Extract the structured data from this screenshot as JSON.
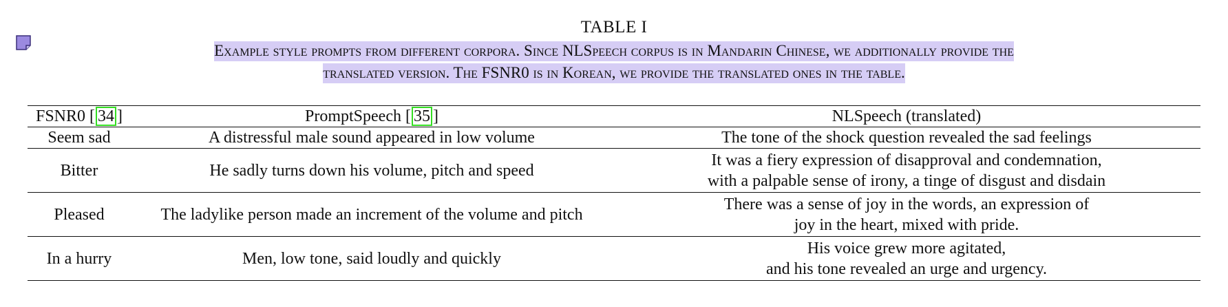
{
  "table_title": "TABLE I",
  "caption": {
    "line1": "Example style prompts from different corpora. Since NLSpeech corpus is in Mandarin Chinese, we additionally provide the",
    "line2": "translated version. The FSNR0 is in Korean, we provide the translated ones in the table."
  },
  "table": {
    "headers": [
      {
        "label": "FSNR0",
        "ref": "34"
      },
      {
        "label": "PromptSpeech",
        "ref": "35"
      },
      {
        "label": "NLSpeech (translated)"
      }
    ],
    "rows": [
      {
        "fsnr0": "Seem sad",
        "promptspeech": "A distressful male sound appeared in low volume",
        "nlspeech": [
          "The tone of the shock question revealed the sad feelings"
        ]
      },
      {
        "fsnr0": "Bitter",
        "promptspeech": "He sadly turns down his volume, pitch and speed",
        "nlspeech": [
          "It was a fiery expression of disapproval and condemnation,",
          "with a palpable sense of irony, a tinge of disgust and disdain"
        ]
      },
      {
        "fsnr0": "Pleased",
        "promptspeech": "The ladylike person made an increment of the volume and pitch",
        "nlspeech": [
          "There was a sense of joy in the words, an expression of",
          "joy in the heart, mixed with pride."
        ]
      },
      {
        "fsnr0": "In a hurry",
        "promptspeech": "Men, low tone, said loudly and quickly",
        "nlspeech": [
          "His voice grew more agitated,",
          "and his tone revealed an urge and urgency."
        ]
      }
    ]
  },
  "colors": {
    "highlight": "#d6cdf5",
    "citation_box": "#33dd22",
    "annotation_icon": "#9b8ae0"
  },
  "icons": {
    "annotation": "sticky-note-icon"
  }
}
